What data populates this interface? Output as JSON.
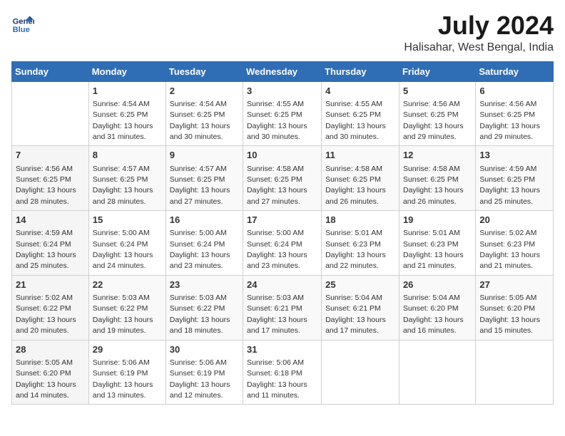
{
  "header": {
    "logo_line1": "General",
    "logo_line2": "Blue",
    "month_year": "July 2024",
    "location": "Halisahar, West Bengal, India"
  },
  "columns": [
    "Sunday",
    "Monday",
    "Tuesday",
    "Wednesday",
    "Thursday",
    "Friday",
    "Saturday"
  ],
  "weeks": [
    [
      {
        "day": "",
        "sunrise": "",
        "sunset": "",
        "daylight": ""
      },
      {
        "day": "1",
        "sunrise": "Sunrise: 4:54 AM",
        "sunset": "Sunset: 6:25 PM",
        "daylight": "Daylight: 13 hours and 31 minutes."
      },
      {
        "day": "2",
        "sunrise": "Sunrise: 4:54 AM",
        "sunset": "Sunset: 6:25 PM",
        "daylight": "Daylight: 13 hours and 30 minutes."
      },
      {
        "day": "3",
        "sunrise": "Sunrise: 4:55 AM",
        "sunset": "Sunset: 6:25 PM",
        "daylight": "Daylight: 13 hours and 30 minutes."
      },
      {
        "day": "4",
        "sunrise": "Sunrise: 4:55 AM",
        "sunset": "Sunset: 6:25 PM",
        "daylight": "Daylight: 13 hours and 30 minutes."
      },
      {
        "day": "5",
        "sunrise": "Sunrise: 4:56 AM",
        "sunset": "Sunset: 6:25 PM",
        "daylight": "Daylight: 13 hours and 29 minutes."
      },
      {
        "day": "6",
        "sunrise": "Sunrise: 4:56 AM",
        "sunset": "Sunset: 6:25 PM",
        "daylight": "Daylight: 13 hours and 29 minutes."
      }
    ],
    [
      {
        "day": "7",
        "sunrise": "Sunrise: 4:56 AM",
        "sunset": "Sunset: 6:25 PM",
        "daylight": "Daylight: 13 hours and 28 minutes."
      },
      {
        "day": "8",
        "sunrise": "Sunrise: 4:57 AM",
        "sunset": "Sunset: 6:25 PM",
        "daylight": "Daylight: 13 hours and 28 minutes."
      },
      {
        "day": "9",
        "sunrise": "Sunrise: 4:57 AM",
        "sunset": "Sunset: 6:25 PM",
        "daylight": "Daylight: 13 hours and 27 minutes."
      },
      {
        "day": "10",
        "sunrise": "Sunrise: 4:58 AM",
        "sunset": "Sunset: 6:25 PM",
        "daylight": "Daylight: 13 hours and 27 minutes."
      },
      {
        "day": "11",
        "sunrise": "Sunrise: 4:58 AM",
        "sunset": "Sunset: 6:25 PM",
        "daylight": "Daylight: 13 hours and 26 minutes."
      },
      {
        "day": "12",
        "sunrise": "Sunrise: 4:58 AM",
        "sunset": "Sunset: 6:25 PM",
        "daylight": "Daylight: 13 hours and 26 minutes."
      },
      {
        "day": "13",
        "sunrise": "Sunrise: 4:59 AM",
        "sunset": "Sunset: 6:25 PM",
        "daylight": "Daylight: 13 hours and 25 minutes."
      }
    ],
    [
      {
        "day": "14",
        "sunrise": "Sunrise: 4:59 AM",
        "sunset": "Sunset: 6:24 PM",
        "daylight": "Daylight: 13 hours and 25 minutes."
      },
      {
        "day": "15",
        "sunrise": "Sunrise: 5:00 AM",
        "sunset": "Sunset: 6:24 PM",
        "daylight": "Daylight: 13 hours and 24 minutes."
      },
      {
        "day": "16",
        "sunrise": "Sunrise: 5:00 AM",
        "sunset": "Sunset: 6:24 PM",
        "daylight": "Daylight: 13 hours and 23 minutes."
      },
      {
        "day": "17",
        "sunrise": "Sunrise: 5:00 AM",
        "sunset": "Sunset: 6:24 PM",
        "daylight": "Daylight: 13 hours and 23 minutes."
      },
      {
        "day": "18",
        "sunrise": "Sunrise: 5:01 AM",
        "sunset": "Sunset: 6:23 PM",
        "daylight": "Daylight: 13 hours and 22 minutes."
      },
      {
        "day": "19",
        "sunrise": "Sunrise: 5:01 AM",
        "sunset": "Sunset: 6:23 PM",
        "daylight": "Daylight: 13 hours and 21 minutes."
      },
      {
        "day": "20",
        "sunrise": "Sunrise: 5:02 AM",
        "sunset": "Sunset: 6:23 PM",
        "daylight": "Daylight: 13 hours and 21 minutes."
      }
    ],
    [
      {
        "day": "21",
        "sunrise": "Sunrise: 5:02 AM",
        "sunset": "Sunset: 6:22 PM",
        "daylight": "Daylight: 13 hours and 20 minutes."
      },
      {
        "day": "22",
        "sunrise": "Sunrise: 5:03 AM",
        "sunset": "Sunset: 6:22 PM",
        "daylight": "Daylight: 13 hours and 19 minutes."
      },
      {
        "day": "23",
        "sunrise": "Sunrise: 5:03 AM",
        "sunset": "Sunset: 6:22 PM",
        "daylight": "Daylight: 13 hours and 18 minutes."
      },
      {
        "day": "24",
        "sunrise": "Sunrise: 5:03 AM",
        "sunset": "Sunset: 6:21 PM",
        "daylight": "Daylight: 13 hours and 17 minutes."
      },
      {
        "day": "25",
        "sunrise": "Sunrise: 5:04 AM",
        "sunset": "Sunset: 6:21 PM",
        "daylight": "Daylight: 13 hours and 17 minutes."
      },
      {
        "day": "26",
        "sunrise": "Sunrise: 5:04 AM",
        "sunset": "Sunset: 6:20 PM",
        "daylight": "Daylight: 13 hours and 16 minutes."
      },
      {
        "day": "27",
        "sunrise": "Sunrise: 5:05 AM",
        "sunset": "Sunset: 6:20 PM",
        "daylight": "Daylight: 13 hours and 15 minutes."
      }
    ],
    [
      {
        "day": "28",
        "sunrise": "Sunrise: 5:05 AM",
        "sunset": "Sunset: 6:20 PM",
        "daylight": "Daylight: 13 hours and 14 minutes."
      },
      {
        "day": "29",
        "sunrise": "Sunrise: 5:06 AM",
        "sunset": "Sunset: 6:19 PM",
        "daylight": "Daylight: 13 hours and 13 minutes."
      },
      {
        "day": "30",
        "sunrise": "Sunrise: 5:06 AM",
        "sunset": "Sunset: 6:19 PM",
        "daylight": "Daylight: 13 hours and 12 minutes."
      },
      {
        "day": "31",
        "sunrise": "Sunrise: 5:06 AM",
        "sunset": "Sunset: 6:18 PM",
        "daylight": "Daylight: 13 hours and 11 minutes."
      },
      {
        "day": "",
        "sunrise": "",
        "sunset": "",
        "daylight": ""
      },
      {
        "day": "",
        "sunrise": "",
        "sunset": "",
        "daylight": ""
      },
      {
        "day": "",
        "sunrise": "",
        "sunset": "",
        "daylight": ""
      }
    ]
  ]
}
